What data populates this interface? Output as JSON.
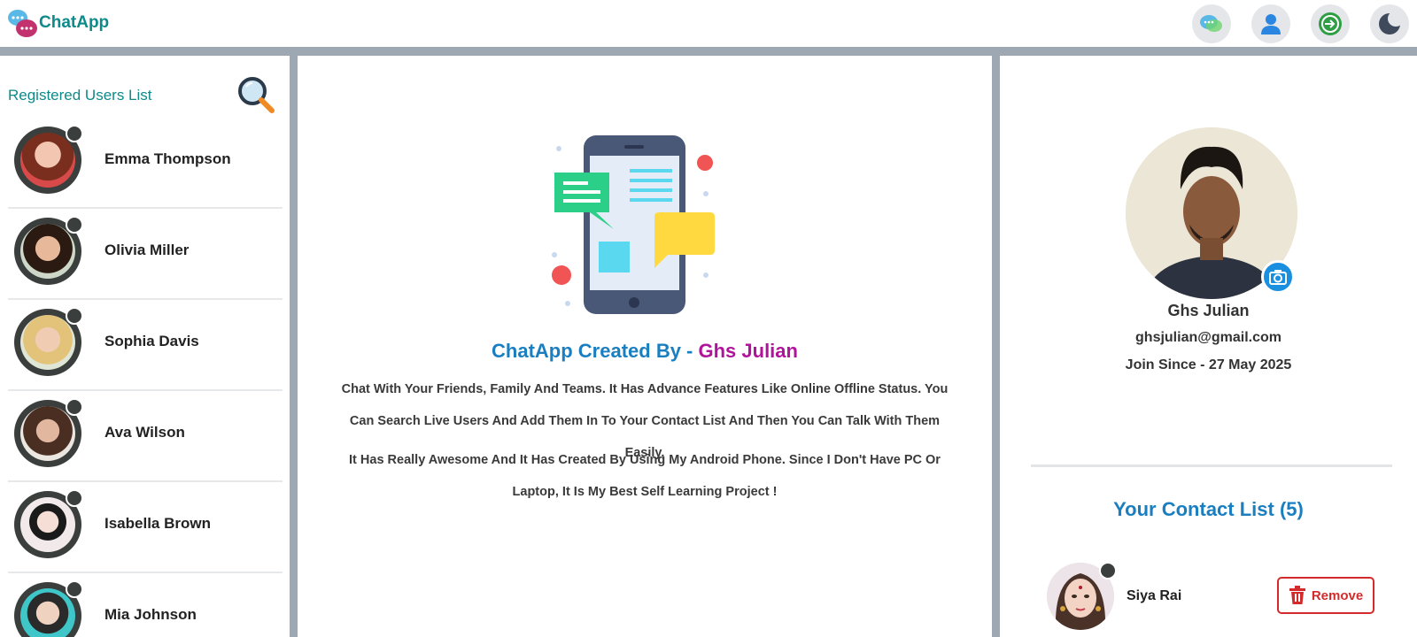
{
  "app": {
    "brand": "ChatApp"
  },
  "header": {
    "icons": [
      "chat-bubbles-icon",
      "user-profile-icon",
      "logout-icon",
      "dark-mode-moon-icon"
    ]
  },
  "users_panel": {
    "title": "Registered Users List",
    "users": [
      {
        "name": "Emma Thompson"
      },
      {
        "name": "Olivia Miller"
      },
      {
        "name": "Sophia Davis"
      },
      {
        "name": "Ava Wilson"
      },
      {
        "name": "Isabella Brown"
      },
      {
        "name": "Mia Johnson"
      }
    ]
  },
  "welcome": {
    "headline_prefix": "ChatApp Created By - ",
    "headline_author": "Ghs Julian",
    "paragraph_1": "Chat With Your Friends, Family And Teams. It Has Advance Features Like Online Offline Status. You Can Search Live Users And Add Them In To Your Contact List And Then You Can Talk With Them Easily.",
    "paragraph_2": "It Has Really Awesome And It Has Created By Using My Android Phone. Since I Don't Have PC Or Laptop, It Is My Best Self Learning Project !"
  },
  "profile": {
    "name": "Ghs Julian",
    "email": "ghsjulian@gmail.com",
    "join": "Join Since - 27 May 2025"
  },
  "contacts": {
    "title": "Your Contact List (5)",
    "items": [
      {
        "name": "Siya Rai",
        "action": "Remove"
      }
    ]
  },
  "colors": {
    "brand": "#0e8a8a",
    "accent_blue": "#1a7fc0",
    "accent_purple": "#b0149a",
    "danger": "#d32b2b"
  }
}
